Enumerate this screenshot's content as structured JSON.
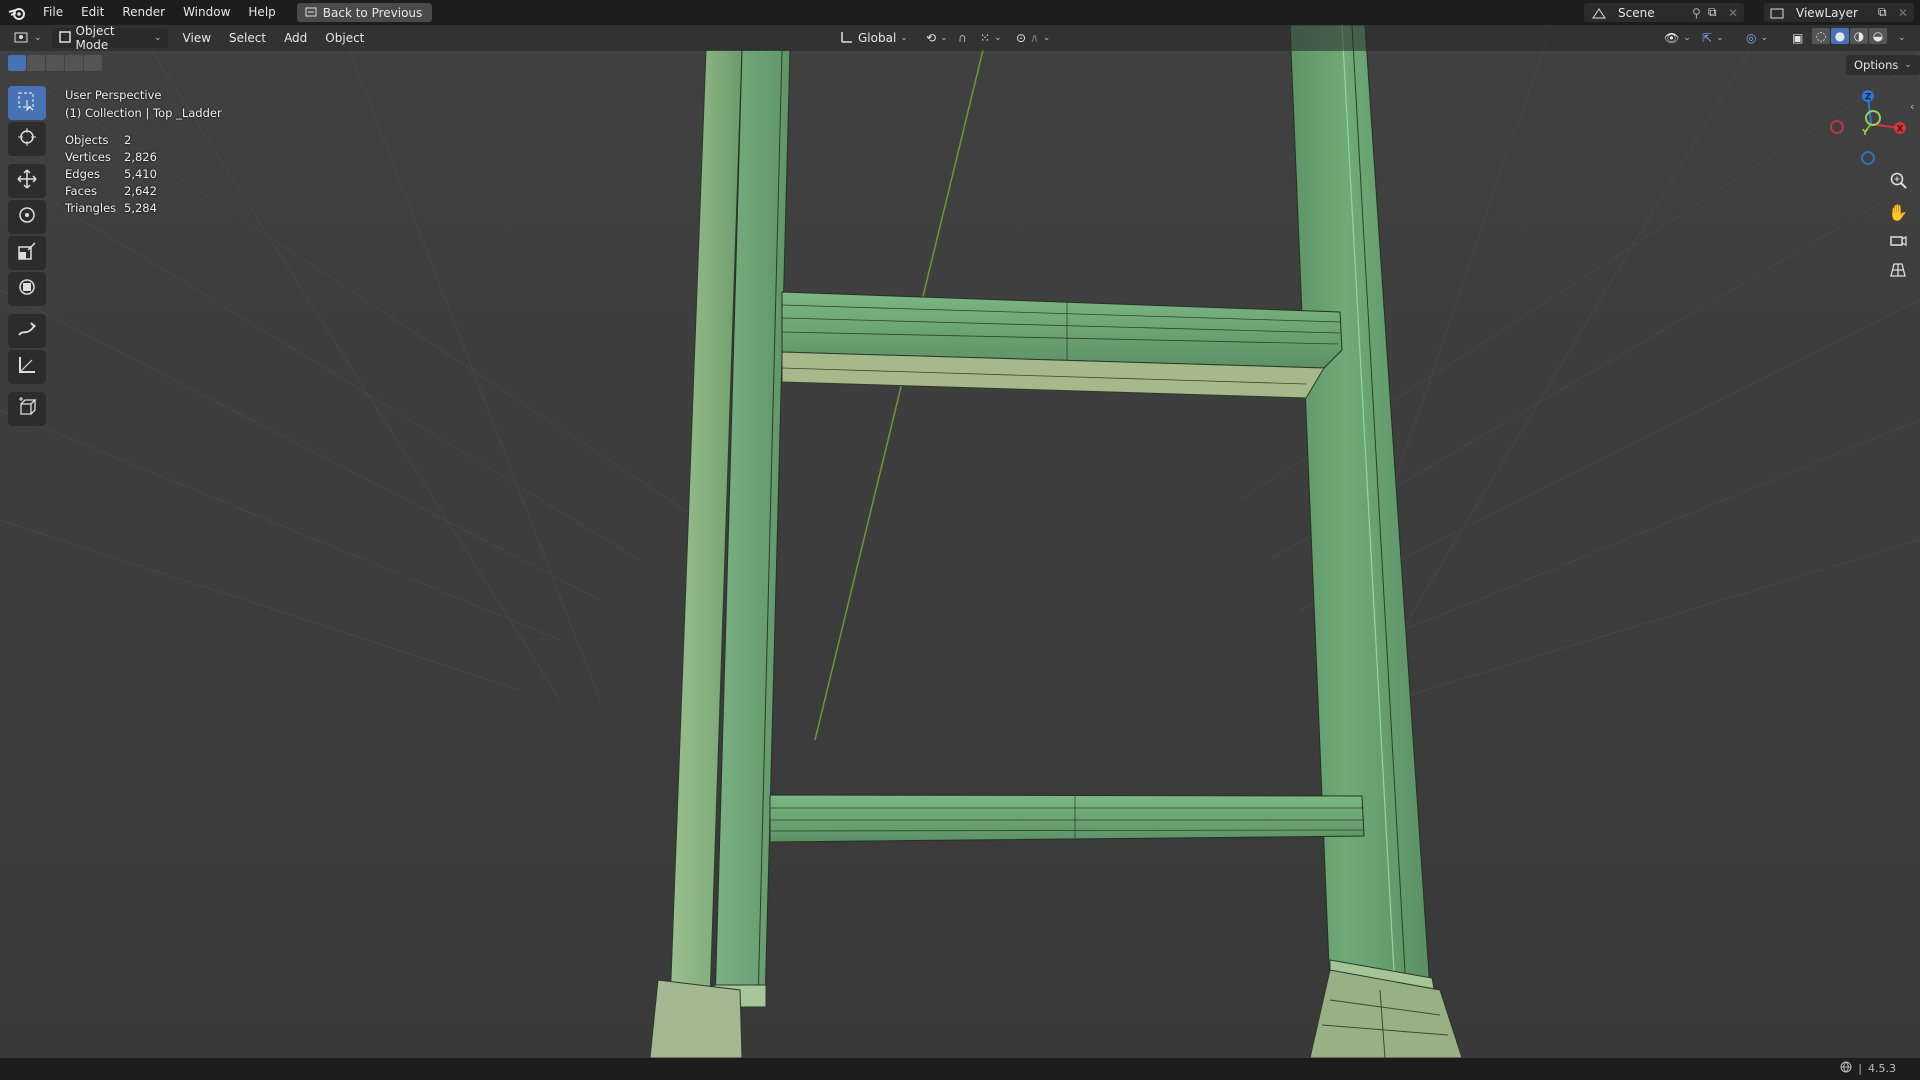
{
  "menu": {
    "items": [
      "File",
      "Edit",
      "Render",
      "Window",
      "Help"
    ],
    "back_button": "Back to Previous"
  },
  "scene": {
    "label": "Scene"
  },
  "view_layer": {
    "label": "ViewLayer"
  },
  "viewport_header": {
    "mode": "Object Mode",
    "menus": [
      "View",
      "Select",
      "Add",
      "Object"
    ],
    "transform_orientation": "Global"
  },
  "overlay": {
    "view_name": "User Perspective",
    "collection_line": "(1) Collection | Top _Ladder",
    "stats": [
      {
        "label": "Objects",
        "value": "2"
      },
      {
        "label": "Vertices",
        "value": "2,826"
      },
      {
        "label": "Edges",
        "value": "5,410"
      },
      {
        "label": "Faces",
        "value": "2,642"
      },
      {
        "label": "Triangles",
        "value": "5,284"
      }
    ]
  },
  "options": {
    "label": "Options"
  },
  "gizmo": {
    "x": "X",
    "y": "Y",
    "z": "Z",
    "x_color": "#d9343e",
    "y_color": "#7ab33d",
    "z_color": "#2f78d9"
  },
  "toolbar": {
    "tools": [
      "select-box-icon",
      "cursor-icon",
      "move-icon",
      "rotate-icon",
      "scale-icon",
      "transform-icon",
      "annotate-icon",
      "measure-icon",
      "add-cube-icon"
    ],
    "active": "select-box-icon"
  },
  "status": {
    "version": "4.5.3"
  },
  "colors": {
    "accent": "#4772b3",
    "ladder": "#6ea77a",
    "background": "#3d3d3d"
  }
}
